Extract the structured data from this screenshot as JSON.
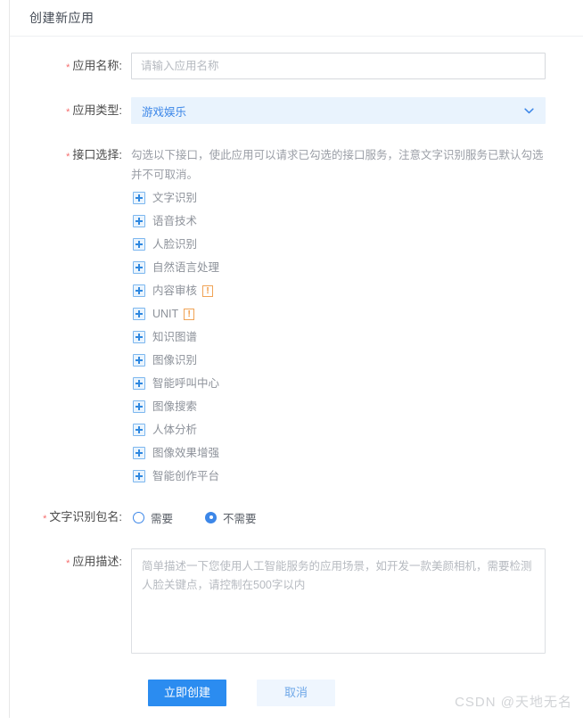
{
  "panel": {
    "title": "创建新应用"
  },
  "form": {
    "app_name": {
      "label": "应用名称:",
      "required": true,
      "placeholder": "请输入应用名称",
      "value": ""
    },
    "app_type": {
      "label": "应用类型:",
      "required": true,
      "selected": "游戏娱乐",
      "chevron_icon": "chevron-down-icon"
    },
    "interfaces": {
      "label": "接口选择:",
      "required": true,
      "hint": "勾选以下接口，使此应用可以请求已勾选的接口服务，注意文字识别服务已默认勾选并不可取消。",
      "expander_icon": "plus-square-icon",
      "warning_icon": "exclamation-badge-icon",
      "items": [
        {
          "label": "文字识别",
          "warning": false
        },
        {
          "label": "语音技术",
          "warning": false
        },
        {
          "label": "人脸识别",
          "warning": false
        },
        {
          "label": "自然语言处理",
          "warning": false
        },
        {
          "label": "内容审核",
          "warning": true,
          "warning_text": "!"
        },
        {
          "label": "UNIT",
          "warning": true,
          "warning_text": "!"
        },
        {
          "label": "知识图谱",
          "warning": false
        },
        {
          "label": "图像识别",
          "warning": false
        },
        {
          "label": "智能呼叫中心",
          "warning": false
        },
        {
          "label": "图像搜索",
          "warning": false
        },
        {
          "label": "人体分析",
          "warning": false
        },
        {
          "label": "图像效果增强",
          "warning": false
        },
        {
          "label": "智能创作平台",
          "warning": false
        }
      ]
    },
    "ocr_package": {
      "label": "文字识别包名:",
      "required": true,
      "options": [
        {
          "label": "需要",
          "checked": false
        },
        {
          "label": "不需要",
          "checked": true
        }
      ]
    },
    "description": {
      "label": "应用描述:",
      "required": true,
      "placeholder": "简单描述一下您使用人工智能服务的应用场景，如开发一款美颜相机，需要检测人脸关键点，请控制在500字以内",
      "value": ""
    }
  },
  "actions": {
    "submit_label": "立即创建",
    "cancel_label": "取消"
  },
  "watermark": {
    "text": "CSDN @天地无名"
  },
  "colors": {
    "primary": "#2b8cf0",
    "link": "#3d87e8",
    "required_star": "#f56c6c",
    "warning": "#f0943a",
    "select_bg": "#e9f3fd",
    "ghost_bg": "#eff6fe"
  }
}
